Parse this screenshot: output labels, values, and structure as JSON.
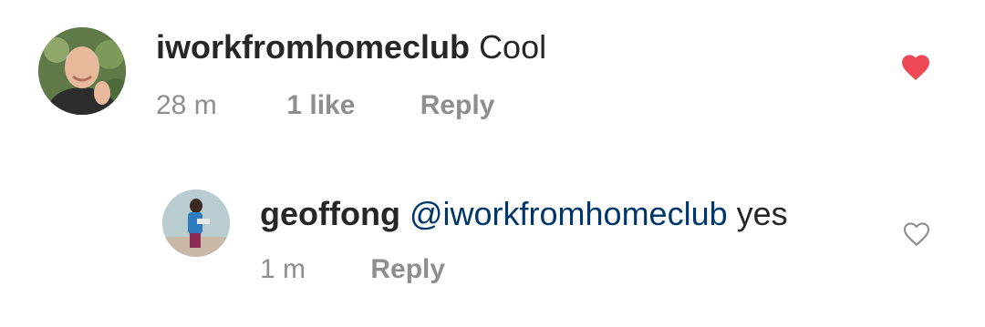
{
  "comments": [
    {
      "username": "iworkfromhomeclub",
      "text": "Cool",
      "time": "28 m",
      "likes": "1 like",
      "reply_label": "Reply",
      "liked": true,
      "heart_icon": "heart-filled-icon"
    },
    {
      "username": "geoffong",
      "mention": "@iworkfromhomeclub",
      "text": "yes",
      "time": "1 m",
      "reply_label": "Reply",
      "liked": false,
      "heart_icon": "heart-outline-icon"
    }
  ],
  "colors": {
    "text": "#262626",
    "meta": "#8e8e8e",
    "mention": "#00376b",
    "heart_liked": "#ed4956",
    "heart_outline": "#8e8e8e"
  }
}
